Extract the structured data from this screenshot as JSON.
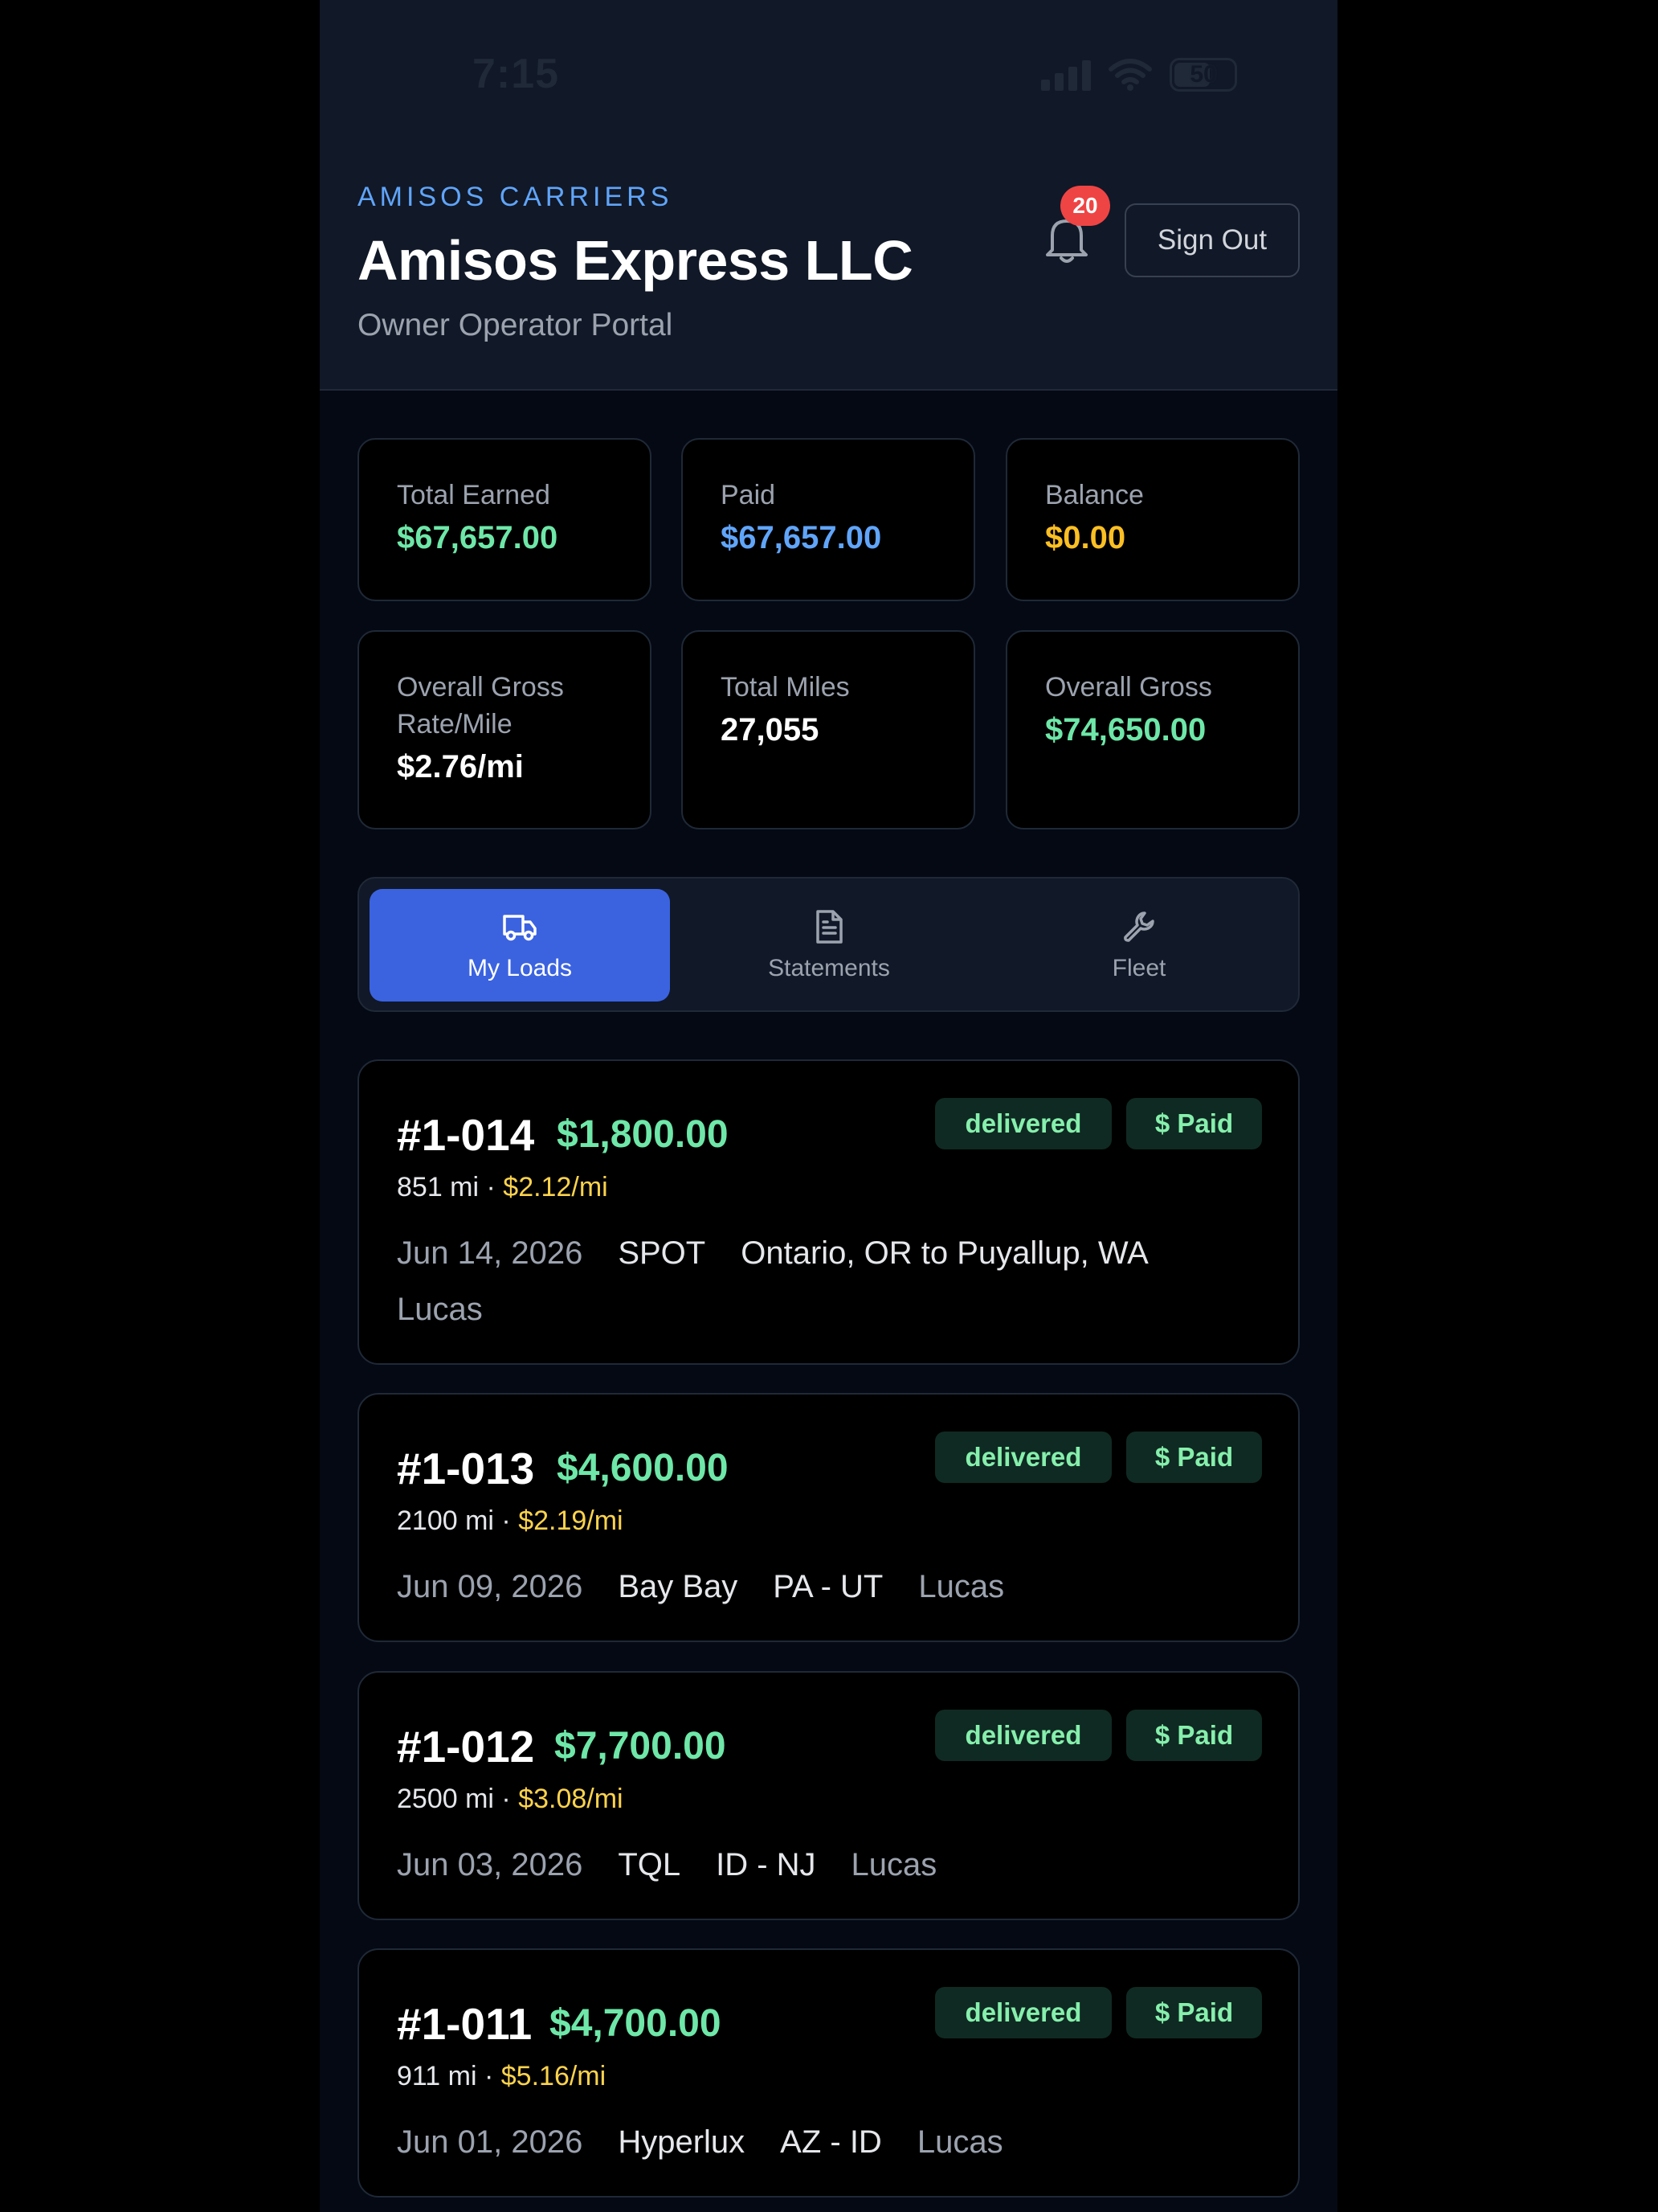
{
  "status_bar": {
    "time": "7:15",
    "battery": "50",
    "icons": [
      "signal-icon",
      "wifi-icon",
      "battery-icon"
    ]
  },
  "header": {
    "brand": "AMISOS CARRIERS",
    "company": "Amisos Express LLC",
    "subtitle": "Owner Operator Portal",
    "notifications_count": "20",
    "sign_out_label": "Sign Out"
  },
  "stats": [
    {
      "label": "Total Earned",
      "value": "$67,657.00"
    },
    {
      "label": "Paid",
      "value": "$67,657.00"
    },
    {
      "label": "Balance",
      "value": "$0.00"
    },
    {
      "label": "Overall Gross Rate/Mile",
      "value": "$2.76/mi"
    },
    {
      "label": "Total Miles",
      "value": "27,055"
    },
    {
      "label": "Overall Gross",
      "value": "$74,650.00"
    }
  ],
  "tabs": [
    {
      "label": "My Loads",
      "icon": "truck-icon",
      "active": true
    },
    {
      "label": "Statements",
      "icon": "document-icon",
      "active": false
    },
    {
      "label": "Fleet",
      "icon": "wrench-icon",
      "active": false
    }
  ],
  "loads": [
    {
      "number": "#1-014",
      "amount": "$1,800.00",
      "miles": "851 mi",
      "separator": "·",
      "rate": "$2.12/mi",
      "date": "Jun 14, 2026",
      "broker": "SPOT",
      "route": "Ontario, OR to Puyallup, WA",
      "driver": "Lucas",
      "status": "delivered",
      "payment": "$ Paid"
    },
    {
      "number": "#1-013",
      "amount": "$4,600.00",
      "miles": "2100 mi",
      "separator": "·",
      "rate": "$2.19/mi",
      "date": "Jun 09, 2026",
      "broker": "Bay Bay",
      "route": "PA - UT",
      "driver": "Lucas",
      "status": "delivered",
      "payment": "$ Paid"
    },
    {
      "number": "#1-012",
      "amount": "$7,700.00",
      "miles": "2500 mi",
      "separator": "·",
      "rate": "$3.08/mi",
      "date": "Jun 03, 2026",
      "broker": "TQL",
      "route": "ID - NJ",
      "driver": "Lucas",
      "status": "delivered",
      "payment": "$ Paid"
    },
    {
      "number": "#1-011",
      "amount": "$4,700.00",
      "miles": "911 mi",
      "separator": "·",
      "rate": "$5.16/mi",
      "date": "Jun 01, 2026",
      "broker": "Hyperlux",
      "route": "AZ - ID",
      "driver": "Lucas",
      "status": "delivered",
      "payment": "$ Paid"
    }
  ],
  "colors": {
    "accent": "#3b63e0",
    "brand": "#60a5fa",
    "money_green": "#6ee7a8",
    "rate_yellow": "#fcd34d",
    "badge_bg": "#0f2a22",
    "notification_red": "#ef4444"
  }
}
